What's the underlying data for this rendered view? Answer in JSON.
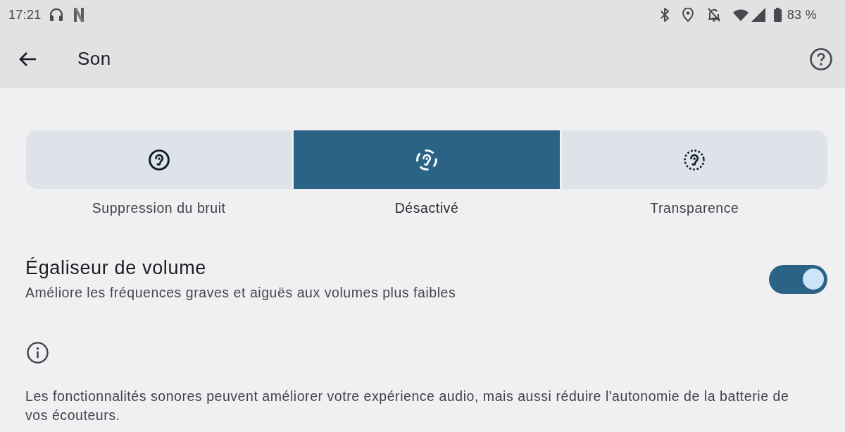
{
  "status_bar": {
    "time": "17:21",
    "battery": "83 %"
  },
  "toolbar": {
    "title": "Son"
  },
  "modes": [
    {
      "kind": "anc",
      "label": "Suppression du bruit",
      "selected": false
    },
    {
      "kind": "off",
      "label": "Désactivé",
      "selected": true
    },
    {
      "kind": "transparency",
      "label": "Transparence",
      "selected": false
    }
  ],
  "settings": [
    {
      "title": "Égaliseur de volume",
      "subtitle": "Améliore les fréquences graves et aiguës aux volumes plus faibles",
      "on": true
    }
  ],
  "info": {
    "text": "Les fonctionnalités sonores peuvent améliorer votre expérience audio, mais aussi réduire l'autonomie de la batterie de vos écouteurs."
  }
}
